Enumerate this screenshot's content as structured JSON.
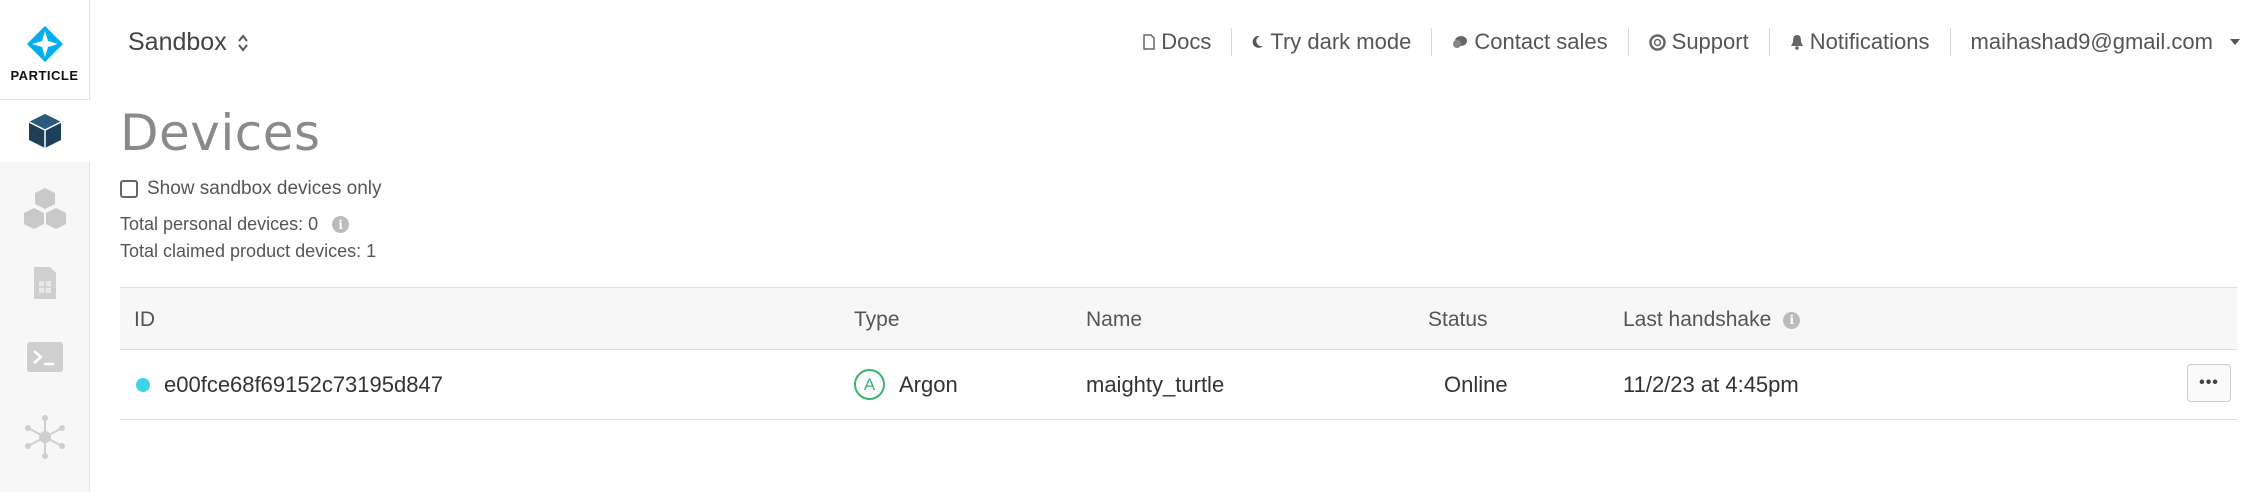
{
  "brand": {
    "name": "PARTICLE",
    "accent": "#00aeef"
  },
  "sidebar": {
    "items": [
      {
        "icon": "cube-icon",
        "active": true
      },
      {
        "icon": "cubes-icon",
        "active": false
      },
      {
        "icon": "sim-card-icon",
        "active": false
      },
      {
        "icon": "terminal-icon",
        "active": false
      },
      {
        "icon": "network-icon",
        "active": false
      }
    ]
  },
  "header": {
    "environment": "Sandbox",
    "nav": {
      "docs": "Docs",
      "dark_mode": "Try dark mode",
      "contact_sales": "Contact sales",
      "support": "Support",
      "notifications": "Notifications",
      "account": "maihashad9@gmail.com"
    }
  },
  "page": {
    "title": "Devices",
    "sandbox_filter_label": "Show sandbox devices only",
    "total_personal": "Total personal devices: 0",
    "total_claimed": "Total claimed product devices: 1"
  },
  "table": {
    "columns": {
      "id": "ID",
      "type": "Type",
      "name": "Name",
      "status": "Status",
      "last_handshake": "Last handshake"
    },
    "rows": [
      {
        "id": "e00fce68f69152c73195d847",
        "type_letter": "A",
        "type": "Argon",
        "name": "maighty_turtle",
        "status": "Online",
        "last_handshake": "11/2/23 at 4:45pm",
        "more": "•••"
      }
    ]
  },
  "colors": {
    "online": "#3fd3ec",
    "argon": "#3cb371"
  }
}
